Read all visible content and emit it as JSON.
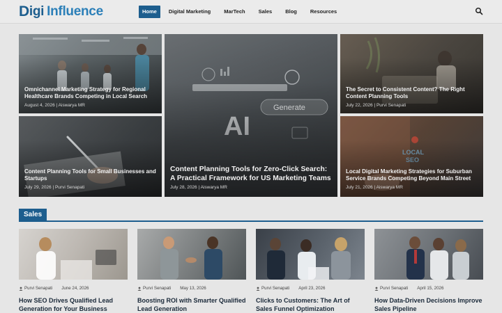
{
  "header": {
    "logo": {
      "initial": "D",
      "rest": "igi",
      "second": "Influence"
    },
    "nav": [
      "Home",
      "Digital Marketing",
      "MarTech",
      "Sales",
      "Blog",
      "Resources"
    ],
    "search_icon": "search-icon"
  },
  "featured": [
    {
      "title": "Omnichannel Marketing Strategy for Regional Healthcare Brands Competing in Local Search",
      "meta": "August 4, 2026 | Aiswarya MR"
    },
    {
      "title": "Content Planning Tools for Zero-Click Search: A Practical Framework for US Marketing Teams",
      "meta": "July 28, 2026 | Aiswarya MR",
      "image_text": {
        "ai": "AI",
        "generate": "Generate"
      }
    },
    {
      "title": "The Secret to Consistent Content? The Right Content Planning Tools",
      "meta": "July 22, 2026 | Purvi Senapati"
    },
    {
      "title": "Content Planning Tools for Small Businesses and Startups",
      "meta": "July 29, 2026 | Purvi Senapati"
    },
    {
      "title": "Local Digital Marketing Strategies for Suburban Service Brands Competing Beyond Main Street",
      "meta": "July 21, 2026 | Aiswarya MR",
      "image_text": {
        "local": "LOCAL",
        "seo": "SEO"
      }
    }
  ],
  "sales_section": {
    "label": "Sales",
    "posts": [
      {
        "author": "Purvi Senapati",
        "date": "June 24, 2026",
        "title": "How SEO Drives Qualified Lead Generation for Your Business"
      },
      {
        "author": "Purvi Senapati",
        "date": "May 13, 2026",
        "title": "Boosting ROI with Smarter Qualified Lead Generation"
      },
      {
        "author": "Purvi Senapati",
        "date": "April 23, 2026",
        "title": "Clicks to Customers: The Art of Sales Funnel Optimization"
      },
      {
        "author": "Purvi Senapati",
        "date": "April 15, 2026",
        "title": "How Data-Driven Decisions Improve Sales Pipeline"
      }
    ]
  },
  "colors": {
    "brand": "#1d5e8e",
    "brand_light": "#2b7fb8",
    "overlay_text": "#f2f2f2"
  }
}
